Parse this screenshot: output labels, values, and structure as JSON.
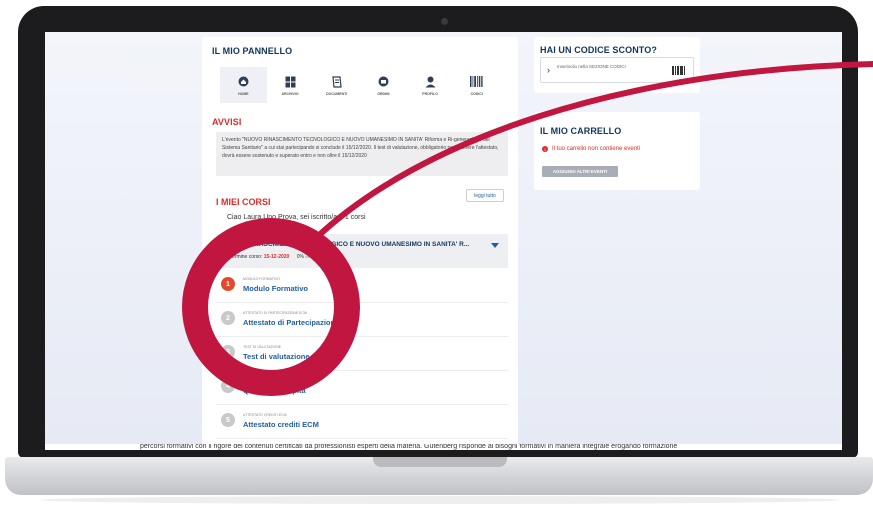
{
  "panel": {
    "title": "IL MIO PANNELLO",
    "tabs": [
      {
        "label": "HOME",
        "icon": "home-icon"
      },
      {
        "label": "ARCHIVIO",
        "icon": "archive-icon"
      },
      {
        "label": "DOCUMENTI",
        "icon": "document-icon"
      },
      {
        "label": "ORDINI",
        "icon": "orders-icon"
      },
      {
        "label": "PROFILO",
        "icon": "user-icon"
      },
      {
        "label": "CODICI",
        "icon": "barcode-icon"
      }
    ]
  },
  "avvisi": {
    "title": "AVVISI",
    "text": "L'evento \"NUOVO RINASCIMENTO TECNOLOGICO E NUOVO UMANESIMO IN SANITA' Riforma e Ri-generazione del Sistema Sanitario\" a cui stai partecipando si conclude il 15/12/2020. Il test di valutazione, obbligatorio per ottenere l'attestato, dovrà essere sostenuto e superato entro e non oltre il 15/12/2020",
    "button": "leggi tutto"
  },
  "courses": {
    "title": "I MIEI CORSI",
    "enrollment": "Ciao Laura Uno Prova, sei iscritto/a a 1 corsi",
    "course_title": "NUOVO RINASCIMENTO TECNOLOGICO E NUOVO UMANESIMO IN SANITA' R...",
    "deadline_label": "Termine corso:",
    "deadline_date": "15-12-2020",
    "progress_text": "0%",
    "modules": [
      {
        "num": "1",
        "caption": "MODULO FORMATIVO",
        "name": "Modulo Formativo"
      },
      {
        "num": "2",
        "caption": "ATTESTATO DI PARTECIPAZIONE ECM",
        "name": "Attestato di Partecipazione"
      },
      {
        "num": "3",
        "caption": "TEST DI VALUTAZIONE",
        "name": "Test di valutazione"
      },
      {
        "num": "4",
        "caption": "QUALITA' PERCEPITA ECM",
        "name": "Qualita' percepita"
      },
      {
        "num": "5",
        "caption": "ATTESTATO CREDITI ECM",
        "name": "Attestato crediti ECM"
      }
    ]
  },
  "discount": {
    "title": "HAI UN CODICE SCONTO?",
    "placeholder": "Inseriscilo nella SEZIONE CODICI"
  },
  "cart": {
    "title": "IL MIO CARRELLO",
    "empty_msg": "Il tuo carrello non contiene eventi",
    "button": "AGGIUNGI ALTRI EVENTI"
  },
  "footer_text": "percorsi formativi con il rigore dei contenuti certificati da professionisti esperti della materia. Gutenberg risponde ai bisogni formativi in maniera integrale erogando formazione",
  "colors": {
    "accent": "#c0163f",
    "title_blue": "#12355b",
    "link_blue": "#1f5fa8",
    "alert_red": "#e02a2a"
  }
}
